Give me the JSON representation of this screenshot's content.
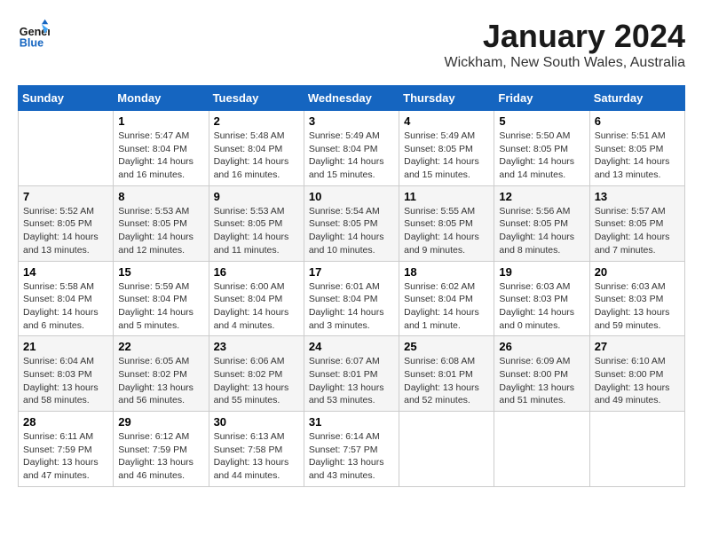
{
  "header": {
    "logo_line1": "General",
    "logo_line2": "Blue",
    "month_title": "January 2024",
    "location": "Wickham, New South Wales, Australia"
  },
  "weekdays": [
    "Sunday",
    "Monday",
    "Tuesday",
    "Wednesday",
    "Thursday",
    "Friday",
    "Saturday"
  ],
  "weeks": [
    [
      {
        "day": "",
        "sunrise": "",
        "sunset": "",
        "daylight": ""
      },
      {
        "day": "1",
        "sunrise": "Sunrise: 5:47 AM",
        "sunset": "Sunset: 8:04 PM",
        "daylight": "Daylight: 14 hours and 16 minutes."
      },
      {
        "day": "2",
        "sunrise": "Sunrise: 5:48 AM",
        "sunset": "Sunset: 8:04 PM",
        "daylight": "Daylight: 14 hours and 16 minutes."
      },
      {
        "day": "3",
        "sunrise": "Sunrise: 5:49 AM",
        "sunset": "Sunset: 8:04 PM",
        "daylight": "Daylight: 14 hours and 15 minutes."
      },
      {
        "day": "4",
        "sunrise": "Sunrise: 5:49 AM",
        "sunset": "Sunset: 8:05 PM",
        "daylight": "Daylight: 14 hours and 15 minutes."
      },
      {
        "day": "5",
        "sunrise": "Sunrise: 5:50 AM",
        "sunset": "Sunset: 8:05 PM",
        "daylight": "Daylight: 14 hours and 14 minutes."
      },
      {
        "day": "6",
        "sunrise": "Sunrise: 5:51 AM",
        "sunset": "Sunset: 8:05 PM",
        "daylight": "Daylight: 14 hours and 13 minutes."
      }
    ],
    [
      {
        "day": "7",
        "sunrise": "Sunrise: 5:52 AM",
        "sunset": "Sunset: 8:05 PM",
        "daylight": "Daylight: 14 hours and 13 minutes."
      },
      {
        "day": "8",
        "sunrise": "Sunrise: 5:53 AM",
        "sunset": "Sunset: 8:05 PM",
        "daylight": "Daylight: 14 hours and 12 minutes."
      },
      {
        "day": "9",
        "sunrise": "Sunrise: 5:53 AM",
        "sunset": "Sunset: 8:05 PM",
        "daylight": "Daylight: 14 hours and 11 minutes."
      },
      {
        "day": "10",
        "sunrise": "Sunrise: 5:54 AM",
        "sunset": "Sunset: 8:05 PM",
        "daylight": "Daylight: 14 hours and 10 minutes."
      },
      {
        "day": "11",
        "sunrise": "Sunrise: 5:55 AM",
        "sunset": "Sunset: 8:05 PM",
        "daylight": "Daylight: 14 hours and 9 minutes."
      },
      {
        "day": "12",
        "sunrise": "Sunrise: 5:56 AM",
        "sunset": "Sunset: 8:05 PM",
        "daylight": "Daylight: 14 hours and 8 minutes."
      },
      {
        "day": "13",
        "sunrise": "Sunrise: 5:57 AM",
        "sunset": "Sunset: 8:05 PM",
        "daylight": "Daylight: 14 hours and 7 minutes."
      }
    ],
    [
      {
        "day": "14",
        "sunrise": "Sunrise: 5:58 AM",
        "sunset": "Sunset: 8:04 PM",
        "daylight": "Daylight: 14 hours and 6 minutes."
      },
      {
        "day": "15",
        "sunrise": "Sunrise: 5:59 AM",
        "sunset": "Sunset: 8:04 PM",
        "daylight": "Daylight: 14 hours and 5 minutes."
      },
      {
        "day": "16",
        "sunrise": "Sunrise: 6:00 AM",
        "sunset": "Sunset: 8:04 PM",
        "daylight": "Daylight: 14 hours and 4 minutes."
      },
      {
        "day": "17",
        "sunrise": "Sunrise: 6:01 AM",
        "sunset": "Sunset: 8:04 PM",
        "daylight": "Daylight: 14 hours and 3 minutes."
      },
      {
        "day": "18",
        "sunrise": "Sunrise: 6:02 AM",
        "sunset": "Sunset: 8:04 PM",
        "daylight": "Daylight: 14 hours and 1 minute."
      },
      {
        "day": "19",
        "sunrise": "Sunrise: 6:03 AM",
        "sunset": "Sunset: 8:03 PM",
        "daylight": "Daylight: 14 hours and 0 minutes."
      },
      {
        "day": "20",
        "sunrise": "Sunrise: 6:03 AM",
        "sunset": "Sunset: 8:03 PM",
        "daylight": "Daylight: 13 hours and 59 minutes."
      }
    ],
    [
      {
        "day": "21",
        "sunrise": "Sunrise: 6:04 AM",
        "sunset": "Sunset: 8:03 PM",
        "daylight": "Daylight: 13 hours and 58 minutes."
      },
      {
        "day": "22",
        "sunrise": "Sunrise: 6:05 AM",
        "sunset": "Sunset: 8:02 PM",
        "daylight": "Daylight: 13 hours and 56 minutes."
      },
      {
        "day": "23",
        "sunrise": "Sunrise: 6:06 AM",
        "sunset": "Sunset: 8:02 PM",
        "daylight": "Daylight: 13 hours and 55 minutes."
      },
      {
        "day": "24",
        "sunrise": "Sunrise: 6:07 AM",
        "sunset": "Sunset: 8:01 PM",
        "daylight": "Daylight: 13 hours and 53 minutes."
      },
      {
        "day": "25",
        "sunrise": "Sunrise: 6:08 AM",
        "sunset": "Sunset: 8:01 PM",
        "daylight": "Daylight: 13 hours and 52 minutes."
      },
      {
        "day": "26",
        "sunrise": "Sunrise: 6:09 AM",
        "sunset": "Sunset: 8:00 PM",
        "daylight": "Daylight: 13 hours and 51 minutes."
      },
      {
        "day": "27",
        "sunrise": "Sunrise: 6:10 AM",
        "sunset": "Sunset: 8:00 PM",
        "daylight": "Daylight: 13 hours and 49 minutes."
      }
    ],
    [
      {
        "day": "28",
        "sunrise": "Sunrise: 6:11 AM",
        "sunset": "Sunset: 7:59 PM",
        "daylight": "Daylight: 13 hours and 47 minutes."
      },
      {
        "day": "29",
        "sunrise": "Sunrise: 6:12 AM",
        "sunset": "Sunset: 7:59 PM",
        "daylight": "Daylight: 13 hours and 46 minutes."
      },
      {
        "day": "30",
        "sunrise": "Sunrise: 6:13 AM",
        "sunset": "Sunset: 7:58 PM",
        "daylight": "Daylight: 13 hours and 44 minutes."
      },
      {
        "day": "31",
        "sunrise": "Sunrise: 6:14 AM",
        "sunset": "Sunset: 7:57 PM",
        "daylight": "Daylight: 13 hours and 43 minutes."
      },
      {
        "day": "",
        "sunrise": "",
        "sunset": "",
        "daylight": ""
      },
      {
        "day": "",
        "sunrise": "",
        "sunset": "",
        "daylight": ""
      },
      {
        "day": "",
        "sunrise": "",
        "sunset": "",
        "daylight": ""
      }
    ]
  ]
}
